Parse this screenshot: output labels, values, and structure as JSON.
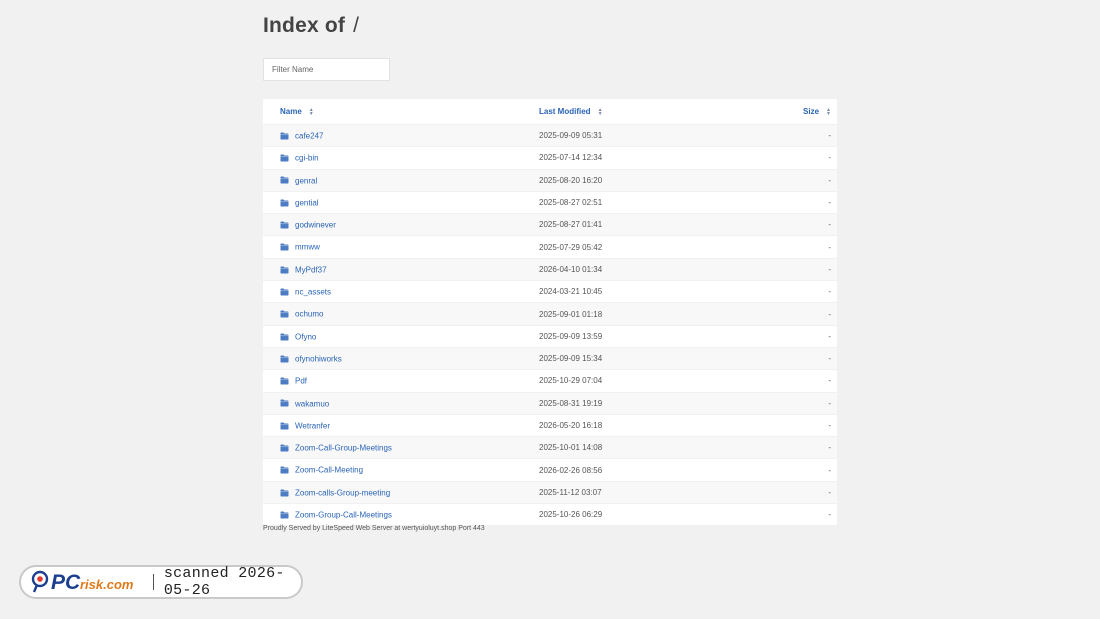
{
  "header": {
    "title": "Index of",
    "path": "/"
  },
  "filter": {
    "placeholder": "Filter Name",
    "value": ""
  },
  "table": {
    "columns": {
      "name": "Name",
      "last_modified": "Last Modified",
      "size": "Size"
    },
    "rows": [
      {
        "name": "cafe247",
        "modified": "2025-09-09 05:31",
        "size": "-"
      },
      {
        "name": "cgi-bin",
        "modified": "2025-07-14 12:34",
        "size": "-"
      },
      {
        "name": "genral",
        "modified": "2025-08-20 16:20",
        "size": "-"
      },
      {
        "name": "gential",
        "modified": "2025-08-27 02:51",
        "size": "-"
      },
      {
        "name": "godwinever",
        "modified": "2025-08-27 01:41",
        "size": "-"
      },
      {
        "name": "mmww",
        "modified": "2025-07-29 05:42",
        "size": "-"
      },
      {
        "name": "MyPdf37",
        "modified": "2026-04-10 01:34",
        "size": "-"
      },
      {
        "name": "nc_assets",
        "modified": "2024-03-21 10:45",
        "size": "-"
      },
      {
        "name": "ochumo",
        "modified": "2025-09-01 01:18",
        "size": "-"
      },
      {
        "name": "Ofyno",
        "modified": "2025-09-09 13:59",
        "size": "-"
      },
      {
        "name": "ofynohiworks",
        "modified": "2025-09-09 15:34",
        "size": "-"
      },
      {
        "name": "Pdf",
        "modified": "2025-10-29 07:04",
        "size": "-"
      },
      {
        "name": "wakamuo",
        "modified": "2025-08-31 19:19",
        "size": "-"
      },
      {
        "name": "Wetranfer",
        "modified": "2026-05-20 16:18",
        "size": "-"
      },
      {
        "name": "Zoom-Call-Group-Meetings",
        "modified": "2025-10-01 14:08",
        "size": "-"
      },
      {
        "name": "Zoom-Call-Meeting",
        "modified": "2026-02-26 08:56",
        "size": "-"
      },
      {
        "name": "Zoom-calls-Group-meeting",
        "modified": "2025-11-12 03:07",
        "size": "-"
      },
      {
        "name": "Zoom-Group-Call-Meetings",
        "modified": "2025-10-26 06:29",
        "size": "-"
      }
    ]
  },
  "footer": {
    "text": "Proudly Served by LiteSpeed Web Server at wertyuioluyt.shop Port 443"
  },
  "watermark": {
    "logo_text": "PCrisk.com",
    "scan_text": "scanned 2026-05-26"
  },
  "colors": {
    "link": "#2a64b6",
    "folder_icon": "#4d7cc2",
    "background": "#f1f1f1"
  },
  "icons": {
    "folder": "folder-icon",
    "sort": "sort-arrows-icon",
    "logo": "pcrisk-logo-icon"
  }
}
